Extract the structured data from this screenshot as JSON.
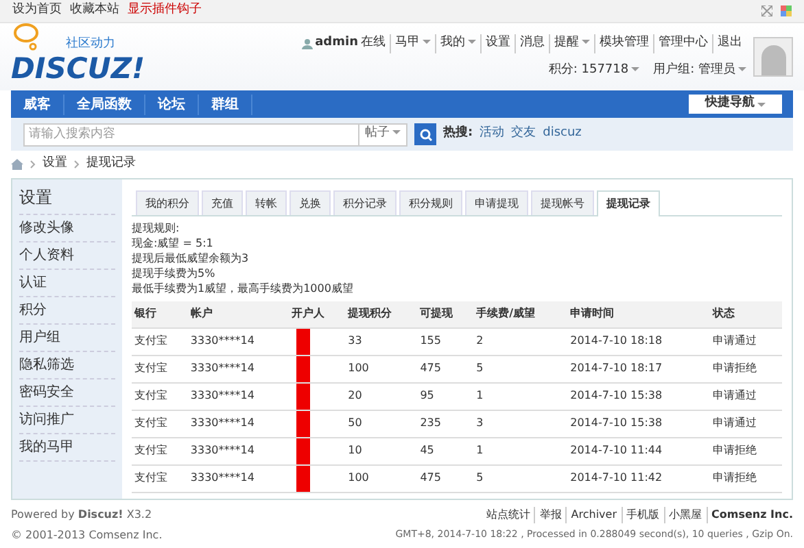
{
  "topbar": {
    "links": [
      "设为首页",
      "收藏本站"
    ],
    "plugin_link": "显示插件钩子"
  },
  "logo": {
    "name": "DISCUZ!",
    "tagline": "社区动力"
  },
  "user": {
    "name": "admin",
    "status": "在线",
    "menu": [
      {
        "label": "马甲",
        "dropdown": true
      },
      {
        "label": "我的",
        "dropdown": true
      },
      {
        "label": "设置",
        "dropdown": false
      },
      {
        "label": "消息",
        "dropdown": false
      },
      {
        "label": "提醒",
        "dropdown": true
      },
      {
        "label": "模块管理",
        "dropdown": false
      },
      {
        "label": "管理中心",
        "dropdown": false
      },
      {
        "label": "退出",
        "dropdown": false
      }
    ],
    "credits": "积分: 157718",
    "group": "用户组: 管理员"
  },
  "nav": {
    "items": [
      "威客",
      "全局函数",
      "论坛",
      "群组"
    ],
    "quick_nav": "快捷导航"
  },
  "search": {
    "placeholder": "请输入搜索内容",
    "scope": "帖子",
    "hot_label": "热搜:",
    "hot": [
      "活动",
      "交友",
      "discuz"
    ]
  },
  "breadcrumb": [
    "设置",
    "提现记录"
  ],
  "sidebar": {
    "title": "设置",
    "items": [
      "修改头像",
      "个人资料",
      "认证",
      "积分",
      "用户组",
      "隐私筛选",
      "密码安全",
      "访问推广",
      "我的马甲"
    ]
  },
  "tabs": [
    {
      "label": "我的积分",
      "selected": false
    },
    {
      "label": "充值",
      "selected": false
    },
    {
      "label": "转帐",
      "selected": false
    },
    {
      "label": "兑换",
      "selected": false
    },
    {
      "label": "积分记录",
      "selected": false
    },
    {
      "label": "积分规则",
      "selected": false
    },
    {
      "label": "申请提现",
      "selected": false
    },
    {
      "label": "提现帐号",
      "selected": false
    },
    {
      "label": "提现记录",
      "selected": true
    }
  ],
  "rules": [
    "提现规则:",
    "现金:威望 = 5:1",
    "提现后最低威望余额为3",
    "提现手续费为5%",
    "最低手续费为1威望，最高手续费为1000威望"
  ],
  "table": {
    "columns": [
      "银行",
      "帐户",
      "开户人",
      "提现积分",
      "可提现",
      "手续费/威望",
      "申请时间",
      "状态"
    ],
    "rows": [
      [
        "支付宝",
        "3330****14",
        "",
        "33",
        "155",
        "2",
        "2014-7-10 18:18",
        "申请通过"
      ],
      [
        "支付宝",
        "3330****14",
        "",
        "100",
        "475",
        "5",
        "2014-7-10 18:17",
        "申请拒绝"
      ],
      [
        "支付宝",
        "3330****14",
        "",
        "20",
        "95",
        "1",
        "2014-7-10 15:38",
        "申请通过"
      ],
      [
        "支付宝",
        "3330****14",
        "",
        "50",
        "235",
        "3",
        "2014-7-10 15:38",
        "申请通过"
      ],
      [
        "支付宝",
        "3330****14",
        "",
        "10",
        "45",
        "1",
        "2014-7-10 11:44",
        "申请拒绝"
      ],
      [
        "支付宝",
        "3330****14",
        "",
        "100",
        "475",
        "5",
        "2014-7-10 11:42",
        "申请拒绝"
      ]
    ]
  },
  "footer": {
    "powered": "Powered by **Discuz!** X3.2",
    "copyright": "© 2001-2013 Comsenz Inc.",
    "links": [
      "站点统计",
      "举报",
      "Archiver",
      "手机版",
      "小黑屋"
    ],
    "company": "Comsenz Inc.",
    "stats": "GMT+8, 2014-7-10 18:22 , Processed in 0.288049 second(s), 10 queries , Gzip On."
  }
}
